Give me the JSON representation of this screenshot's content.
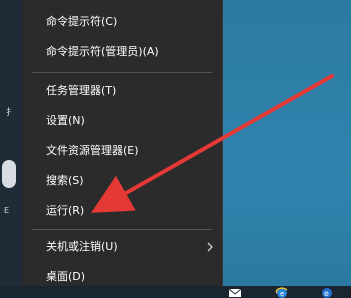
{
  "menu": {
    "items": [
      {
        "label": "命令提示符(C)"
      },
      {
        "label": "命令提示符(管理员)(A)"
      },
      {
        "label": "任务管理器(T)"
      },
      {
        "label": "设置(N)"
      },
      {
        "label": "文件资源管理器(E)"
      },
      {
        "label": "搜索(S)"
      },
      {
        "label": "运行(R)"
      },
      {
        "label": "关机或注销(U)"
      },
      {
        "label": "桌面(D)"
      }
    ]
  },
  "left_strip": {
    "glyph": "扌",
    "text": "E"
  },
  "colors": {
    "menu_bg": "#2b2b2b",
    "desktop": "#2f7fa8",
    "arrow": "#e53935"
  },
  "icons": [
    "mail-icon",
    "ie-icon",
    "edge-icon"
  ]
}
